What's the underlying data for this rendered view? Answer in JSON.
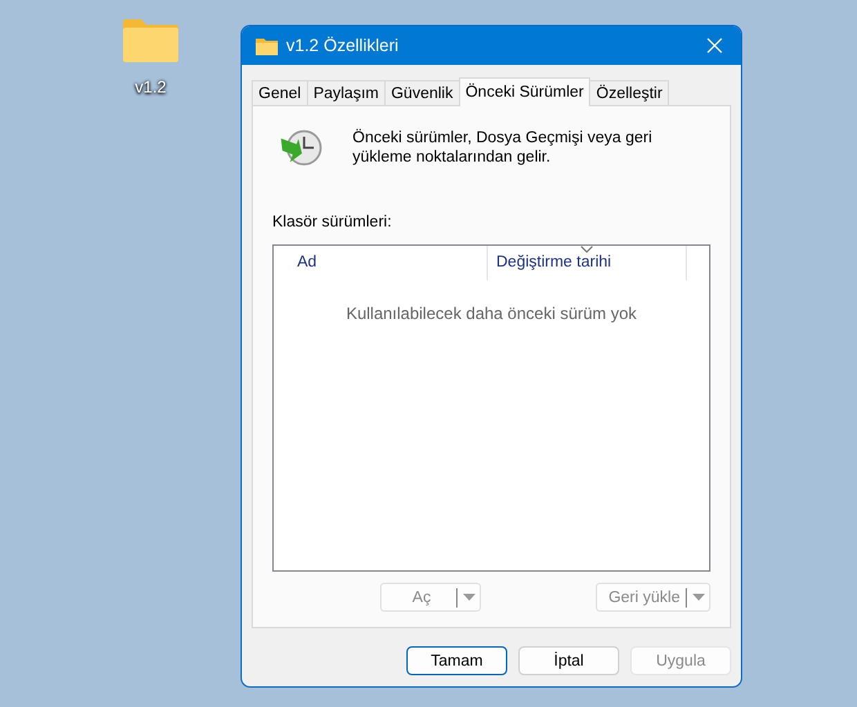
{
  "desktop_icon": {
    "label": "v1.2"
  },
  "window": {
    "title": "v1.2 Özellikleri"
  },
  "tabs": [
    {
      "label": "Genel",
      "selected": false
    },
    {
      "label": "Paylaşım",
      "selected": false
    },
    {
      "label": "Güvenlik",
      "selected": false
    },
    {
      "label": "Önceki Sürümler",
      "selected": true
    },
    {
      "label": "Özelleştir",
      "selected": false
    }
  ],
  "description": "Önceki sürümler, Dosya Geçmişi veya geri yükleme noktalarından gelir.",
  "versions": {
    "label": "Klasör sürümleri:",
    "columns": [
      "Ad",
      "Değiştirme tarihi"
    ],
    "empty_message": "Kullanılabilecek daha önceki sürüm yok"
  },
  "split_buttons": [
    {
      "label": "Aç",
      "disabled": true
    },
    {
      "label": "Geri yükle",
      "disabled": true
    }
  ],
  "buttons": [
    {
      "label": "Tamam",
      "default": true,
      "disabled": false
    },
    {
      "label": "İptal",
      "default": false,
      "disabled": false
    },
    {
      "label": "Uygula",
      "default": false,
      "disabled": true
    }
  ]
}
